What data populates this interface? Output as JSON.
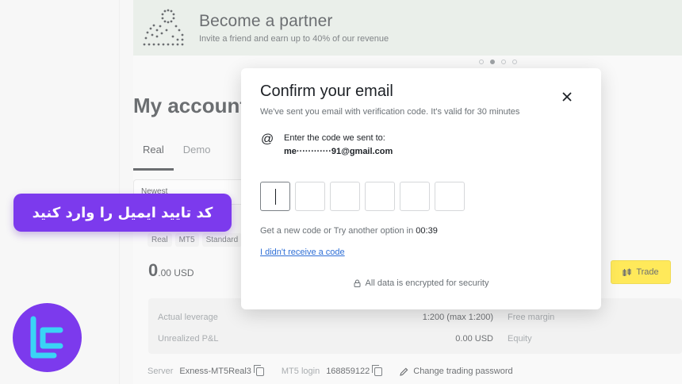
{
  "banner": {
    "title": "Become a partner",
    "subtitle": "Invite a friend and earn up to 40% of our revenue",
    "carousel_dots": 4,
    "active_dot": 1
  },
  "page": {
    "title": "My account",
    "tabs": [
      {
        "label": "Real",
        "active": true
      },
      {
        "label": "Demo",
        "active": false
      }
    ],
    "sort_label": "Newest"
  },
  "account": {
    "badges": [
      "Real",
      "MT5",
      "Standard"
    ],
    "balance_int": "0",
    "balance_dec": ".00 USD",
    "trade_label": "Trade",
    "details": {
      "leverage_label": "Actual leverage",
      "leverage_value": "1:200 (max 1:200)",
      "free_margin_label": "Free margin",
      "pnl_label": "Unrealized P&L",
      "pnl_value": "0.00 USD",
      "equity_label": "Equity"
    },
    "server_label": "Server",
    "server_value": "Exness-MT5Real3",
    "login_label": "MT5 login",
    "login_value": "168859122",
    "change_password_label": "Change trading password"
  },
  "modal": {
    "title": "Confirm your email",
    "subtitle": "We've sent you email with verification code. It's valid for 30 minutes",
    "sent_label": "Enter the code we sent to:",
    "email": "me············91@gmail.com",
    "code_digits": 6,
    "resend_text": "Get a new code or Try another option in ",
    "resend_timer": "00:39",
    "no_code_link": "I didn't receive a code",
    "security_note": "All data is encrypted for security"
  },
  "caption": {
    "text": "کد تایید ایمیل را وارد کنید"
  },
  "colors": {
    "accent_yellow": "#ffde02",
    "caption_purple": "#7c3aed",
    "logo_cyan": "#3ad4f5",
    "link_blue": "#2f6fd6"
  }
}
